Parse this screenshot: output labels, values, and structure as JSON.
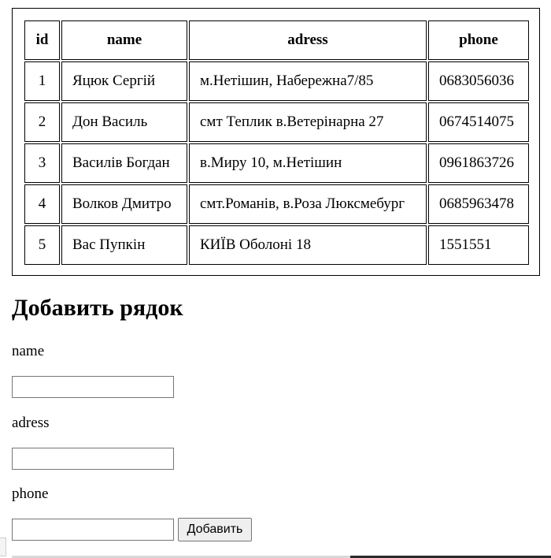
{
  "table": {
    "headers": {
      "id": "id",
      "name": "name",
      "adress": "adress",
      "phone": "phone"
    },
    "rows": [
      {
        "id": "1",
        "name": "Яцюк Сергій",
        "adress": "м.Нетішин, Набережна7/85",
        "phone": "0683056036"
      },
      {
        "id": "2",
        "name": "Дон Василь",
        "adress": "смт Теплик в.Ветерінарна 27",
        "phone": "0674514075"
      },
      {
        "id": "3",
        "name": "Василів Богдан",
        "adress": "в.Миру 10, м.Нетішин",
        "phone": "0961863726"
      },
      {
        "id": "4",
        "name": "Волков Дмитро",
        "adress": "смт.Романів, в.Роза Люксмебург",
        "phone": "0685963478"
      },
      {
        "id": "5",
        "name": "Вас Пупкін",
        "adress": "КИЇВ Оболоні 18",
        "phone": "1551551"
      }
    ]
  },
  "form": {
    "title": "Добавить рядок",
    "name_label": "name",
    "name_value": "",
    "adress_label": "adress",
    "adress_value": "",
    "phone_label": "phone",
    "phone_value": "",
    "submit_label": "Добавить"
  }
}
